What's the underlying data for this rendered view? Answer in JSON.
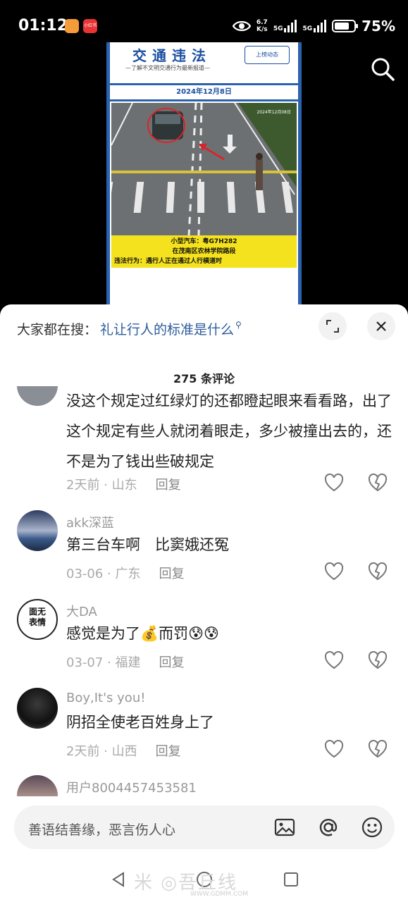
{
  "status_bar": {
    "time": "01:12",
    "app_badge": "小红书",
    "net_speed_value": "6.7",
    "net_speed_unit": "K/s",
    "signal1": "5G",
    "signal2": "5G",
    "battery": "75%"
  },
  "video": {
    "poster_title": "交通违法",
    "poster_subtitle": "—了解不文明交通行为最新报道—",
    "poster_badge": "上榜动态",
    "poster_date": "2024年12月8日",
    "cam_timestamp": "2024年12月08日",
    "caption_line1": "小型汽车：粤G7H282",
    "caption_line2": "在茂南区农林学院路段",
    "caption_line3": "违法行为：遇行人正在通过人行横道时"
  },
  "search_suggest": {
    "prefix": "大家都在搜：",
    "keyword": "礼让行人的标准是什么"
  },
  "comment_count": "275 条评论",
  "comments": [
    {
      "user": "",
      "text": "没这个规定过红绿灯的还都瞪起眼来看看路，出了这个规定有些人就闭着眼走，多少被撞出去的，还不是为了钱出些破规定",
      "time_loc": "2天前 · 山东",
      "reply": "回复"
    },
    {
      "user": "akk深蓝",
      "text": "第三台车啊　比窦娥还冤",
      "time_loc": "03-06 · 广东",
      "reply": "回复"
    },
    {
      "user": "大DA",
      "text": "感觉是为了💰而罚😰😰",
      "time_loc": "03-07 · 福建",
      "reply": "回复",
      "avatar_text": "面无表情"
    },
    {
      "user": "Boy,It's you!",
      "text": "阴招全使老百姓身上了",
      "time_loc": "2天前 · 山西",
      "reply": "回复"
    },
    {
      "user": "用户8004457453581",
      "text": "",
      "time_loc": "",
      "reply": ""
    }
  ],
  "input": {
    "placeholder": "善语结善缘，恶言伤人心"
  },
  "watermark": {
    "main": "米 ◎吾丘线",
    "sub": "WWW.GDMM.COM"
  },
  "colors": {
    "accent_blue": "#2c5c9c",
    "poster_blue": "#2a62b0",
    "caption_yellow": "#f5e21e"
  }
}
